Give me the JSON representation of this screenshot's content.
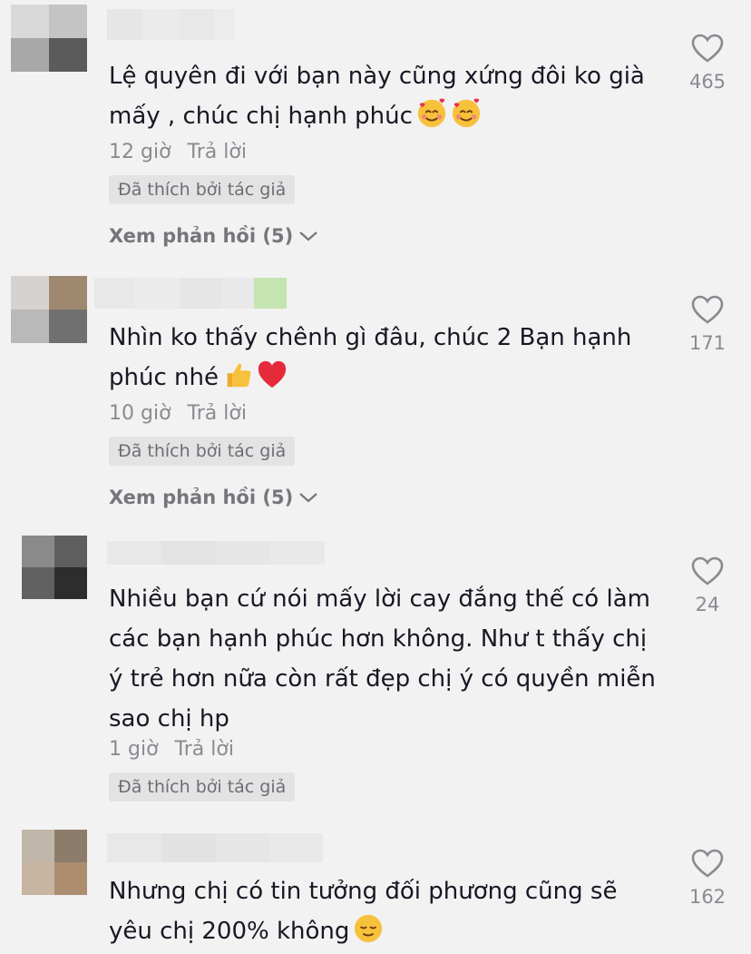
{
  "labels": {
    "reply": "Trả lời",
    "liked_by_author": "Đã thích bởi tác giả",
    "view_replies_prefix": "Xem phản hồi"
  },
  "comments": [
    {
      "text": "Lệ quyên đi với bạn này cũng xứng đôi ko già mấy , chúc chị hạnh phúc",
      "emojis": [
        "smiling-face-with-hearts",
        "smiling-face-with-hearts"
      ],
      "time": "12 giờ",
      "likes": "465",
      "view_replies": "Xem phản hồi (5)"
    },
    {
      "text": "Nhìn ko thấy chênh gì đâu, chúc 2 Bạn hạnh phúc nhé",
      "emojis": [
        "thumbs-up",
        "red-heart"
      ],
      "time": "10 giờ",
      "likes": "171",
      "view_replies": "Xem phản hồi (5)"
    },
    {
      "text": "Nhiều bạn cứ nói mấy lời cay đắng thế có làm các bạn hạnh phúc hơn không. Như t thấy chị ý trẻ hơn nữa còn rất đẹp chị ý có quyền miễn sao chị hp",
      "emojis": [],
      "time": "1 giờ",
      "likes": "24"
    },
    {
      "text": "Nhưng chị có tin tưởng đối phương cũng sẽ yêu chị 200% không",
      "emojis": [
        "relieved-face"
      ],
      "likes": "162"
    }
  ],
  "colors": {
    "background": "#f2f2f2",
    "text": "#161823",
    "secondary": "#8a8b91",
    "badge_bg": "#e3e3e4"
  }
}
